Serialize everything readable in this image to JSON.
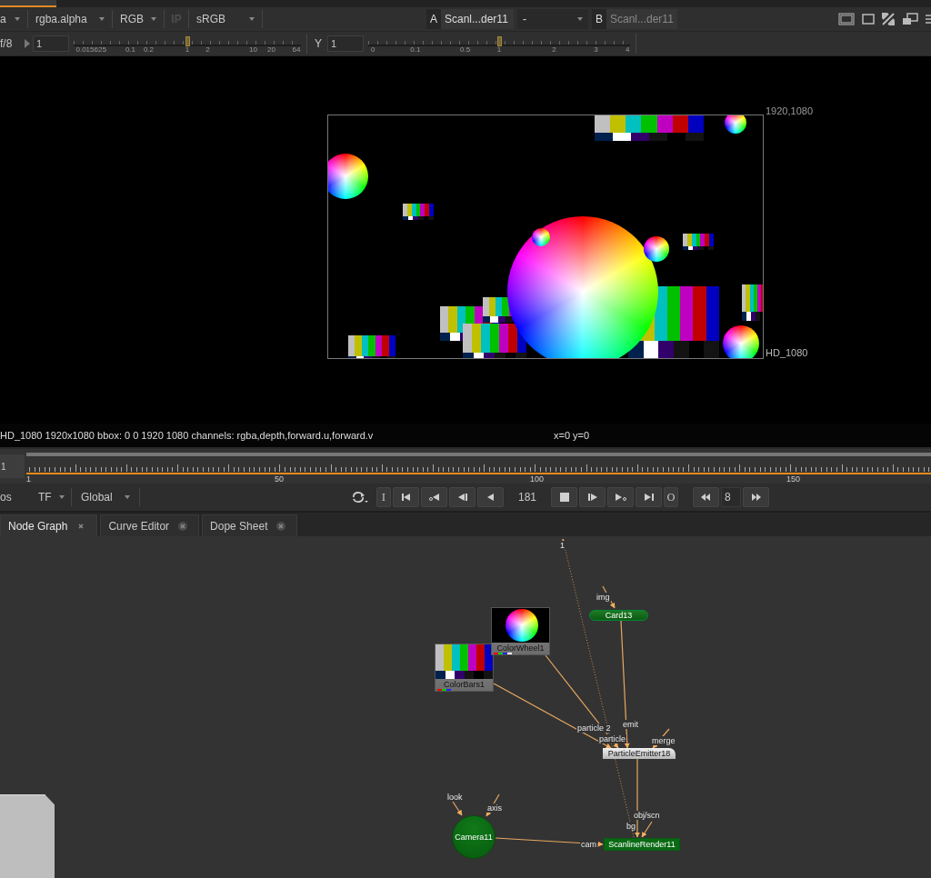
{
  "viewer_toolbar": {
    "channel_set": "a",
    "channel": "rgba.alpha",
    "display": "RGB",
    "ip": {
      "label": "IP",
      "disabled": true
    },
    "colorspace": "sRGB",
    "input_a": {
      "letter": "A",
      "name": "Scanl...der11"
    },
    "wipe_mode": "-",
    "input_b": {
      "letter": "B",
      "name": "Scanl...der11"
    }
  },
  "gain": {
    "label": "f/8",
    "value": "1",
    "level": 0.5,
    "ticks": [
      "0.015625",
      "0.1",
      "0.2",
      "1",
      "2",
      "10",
      "20",
      "64"
    ]
  },
  "gamma": {
    "label": "Y",
    "value": "1",
    "level": 0.5,
    "ticks": [
      "0",
      "0.1",
      "0.5",
      "1",
      "2",
      "3",
      "4"
    ]
  },
  "viewer": {
    "corner_label": "1920,1080",
    "format_label": "HD_1080"
  },
  "info_bar": {
    "text": "HD_1080 1920x1080  bbox: 0 0 1920 1080 channels: rgba,depth,forward.u,forward.v",
    "coords": "x=0 y=0"
  },
  "timeline": {
    "frame_field": "1",
    "labels": [
      "1",
      "50",
      "100",
      "150"
    ]
  },
  "transport": {
    "left_label": "os",
    "tf": "TF",
    "range": "Global",
    "in_button": "I",
    "frame": "181",
    "out_button": "O",
    "increment": "8"
  },
  "tabs": [
    {
      "label": "Node Graph",
      "selected": true
    },
    {
      "label": "Curve Editor",
      "selected": false
    },
    {
      "label": "Dope Sheet",
      "selected": false
    }
  ],
  "node_graph": {
    "nodes": [
      {
        "kind": "colorbars",
        "label": "ColorBars1"
      },
      {
        "kind": "colorwheel",
        "label": "ColorWheel1"
      },
      {
        "kind": "pill",
        "label": "Card13"
      },
      {
        "kind": "emitter",
        "label": "ParticleEmitter18"
      },
      {
        "kind": "camera",
        "label": "Camera11"
      },
      {
        "kind": "render",
        "label": "ScanlineRender11"
      },
      {
        "kind": "backdrop"
      }
    ],
    "input_labels": [
      "1",
      "img",
      "particle 2",
      "particle",
      "emit",
      "merge",
      "look",
      "axis",
      "obj/scn",
      "bg",
      "cam"
    ]
  }
}
